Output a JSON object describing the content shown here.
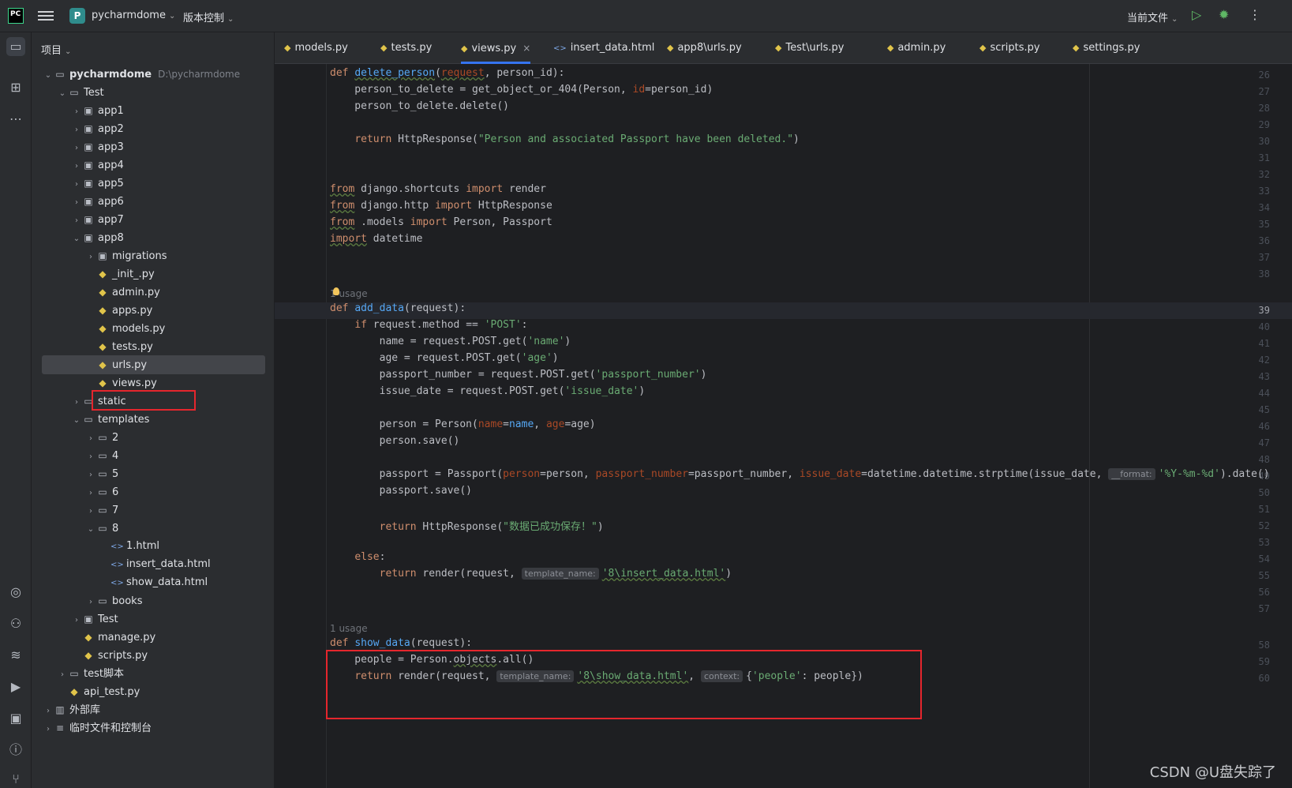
{
  "titlebar": {
    "logo": "PC",
    "project_badge": "P",
    "project_name": "pycharmdome",
    "vcs_label": "版本控制",
    "run_config": "当前文件"
  },
  "project_panel": {
    "title": "项目",
    "tree": [
      {
        "label": "pycharmdome",
        "hint": "D:\\pycharmdome",
        "type": "dir",
        "depth": 0,
        "expanded": true,
        "bold": true
      },
      {
        "label": "Test",
        "type": "dir",
        "depth": 1,
        "expanded": true
      },
      {
        "label": "app1",
        "type": "pkg",
        "depth": 2,
        "expanded": false
      },
      {
        "label": "app2",
        "type": "pkg",
        "depth": 2,
        "expanded": false
      },
      {
        "label": "app3",
        "type": "pkg",
        "depth": 2,
        "expanded": false
      },
      {
        "label": "app4",
        "type": "pkg",
        "depth": 2,
        "expanded": false
      },
      {
        "label": "app5",
        "type": "pkg",
        "depth": 2,
        "expanded": false
      },
      {
        "label": "app6",
        "type": "pkg",
        "depth": 2,
        "expanded": false
      },
      {
        "label": "app7",
        "type": "pkg",
        "depth": 2,
        "expanded": false
      },
      {
        "label": "app8",
        "type": "pkg",
        "depth": 2,
        "expanded": true
      },
      {
        "label": "migrations",
        "type": "pkg",
        "depth": 3,
        "expanded": false
      },
      {
        "label": "_init_.py",
        "type": "py",
        "depth": 3
      },
      {
        "label": "admin.py",
        "type": "py",
        "depth": 3
      },
      {
        "label": "apps.py",
        "type": "py",
        "depth": 3
      },
      {
        "label": "models.py",
        "type": "py",
        "depth": 3
      },
      {
        "label": "tests.py",
        "type": "py",
        "depth": 3
      },
      {
        "label": "urls.py",
        "type": "py",
        "depth": 3,
        "selected": true
      },
      {
        "label": "views.py",
        "type": "py",
        "depth": 3,
        "highlight": true
      },
      {
        "label": "static",
        "type": "dir",
        "depth": 2,
        "expanded": false
      },
      {
        "label": "templates",
        "type": "dir",
        "depth": 2,
        "expanded": true
      },
      {
        "label": "2",
        "type": "dir",
        "depth": 3,
        "expanded": false
      },
      {
        "label": "4",
        "type": "dir",
        "depth": 3,
        "expanded": false
      },
      {
        "label": "5",
        "type": "dir",
        "depth": 3,
        "expanded": false
      },
      {
        "label": "6",
        "type": "dir",
        "depth": 3,
        "expanded": false
      },
      {
        "label": "7",
        "type": "dir",
        "depth": 3,
        "expanded": false
      },
      {
        "label": "8",
        "type": "dir",
        "depth": 3,
        "expanded": true
      },
      {
        "label": "1.html",
        "type": "html",
        "depth": 4
      },
      {
        "label": "insert_data.html",
        "type": "html",
        "depth": 4
      },
      {
        "label": "show_data.html",
        "type": "html",
        "depth": 4
      },
      {
        "label": "books",
        "type": "dir",
        "depth": 3,
        "expanded": false
      },
      {
        "label": "Test",
        "type": "pkg",
        "depth": 2,
        "expanded": false
      },
      {
        "label": "manage.py",
        "type": "py",
        "depth": 2
      },
      {
        "label": "scripts.py",
        "type": "py",
        "depth": 2
      },
      {
        "label": "test脚本",
        "type": "dir",
        "depth": 1,
        "expanded": false
      },
      {
        "label": "api_test.py",
        "type": "py",
        "depth": 1
      },
      {
        "label": "外部库",
        "type": "lib",
        "depth": 0,
        "expanded": false
      },
      {
        "label": "临时文件和控制台",
        "type": "scratch",
        "depth": 0,
        "expanded": false
      }
    ]
  },
  "tabs": [
    {
      "label": "models.py",
      "type": "py"
    },
    {
      "label": "tests.py",
      "type": "py"
    },
    {
      "label": "views.py",
      "type": "py",
      "active": true
    },
    {
      "label": "insert_data.html",
      "type": "html"
    },
    {
      "label": "app8\\urls.py",
      "type": "py"
    },
    {
      "label": "Test\\urls.py",
      "type": "py"
    },
    {
      "label": "admin.py",
      "type": "py"
    },
    {
      "label": "scripts.py",
      "type": "py"
    },
    {
      "label": "settings.py",
      "type": "py"
    }
  ],
  "editor": {
    "current_line": "39",
    "lines": [
      {
        "n": "26",
        "tokens": [
          [
            "def ",
            "kw"
          ],
          [
            "delete_person",
            "fn ul"
          ],
          [
            "(",
            ""
          ],
          [
            "request",
            "pm ul"
          ],
          [
            ", person_id):",
            ""
          ]
        ]
      },
      {
        "n": "27",
        "tokens": [
          [
            "    person_to_delete = get_object_or_404(Person, ",
            ""
          ],
          [
            "id",
            "pm"
          ],
          [
            "=person_id)",
            ""
          ]
        ]
      },
      {
        "n": "28",
        "tokens": [
          [
            "    person_to_delete.delete()",
            ""
          ]
        ]
      },
      {
        "n": "29",
        "tokens": []
      },
      {
        "n": "30",
        "tokens": [
          [
            "    ",
            ""
          ],
          [
            "return",
            "kw"
          ],
          [
            " HttpResponse(",
            ""
          ],
          [
            "\"Person and associated Passport have been deleted.\"",
            "st"
          ],
          [
            ")",
            ""
          ]
        ]
      },
      {
        "n": "31",
        "tokens": []
      },
      {
        "n": "32",
        "tokens": []
      },
      {
        "n": "33",
        "tokens": [
          [
            "from",
            "kw ul"
          ],
          [
            " django.shortcuts ",
            ""
          ],
          [
            "import",
            "kw"
          ],
          [
            " render",
            ""
          ]
        ]
      },
      {
        "n": "34",
        "tokens": [
          [
            "from",
            "kw ul"
          ],
          [
            " django.http ",
            ""
          ],
          [
            "import",
            "kw"
          ],
          [
            " HttpResponse",
            ""
          ]
        ]
      },
      {
        "n": "35",
        "tokens": [
          [
            "from",
            "kw ul"
          ],
          [
            " .models ",
            ""
          ],
          [
            "import",
            "kw"
          ],
          [
            " Person, Passport",
            ""
          ]
        ]
      },
      {
        "n": "36",
        "tokens": [
          [
            "import",
            "kw ul"
          ],
          [
            " datetime",
            ""
          ]
        ]
      },
      {
        "n": "37",
        "tokens": []
      },
      {
        "n": "38",
        "tokens": []
      },
      {
        "n": "39",
        "usage": "1 usage",
        "tokens": [
          [
            "def ",
            "kw"
          ],
          [
            "add_data",
            "fn"
          ],
          [
            "(request):",
            ""
          ]
        ]
      },
      {
        "n": "40",
        "tokens": [
          [
            "    ",
            ""
          ],
          [
            "if",
            "kw"
          ],
          [
            " request.method == ",
            ""
          ],
          [
            "'POST'",
            "st"
          ],
          [
            ":",
            ""
          ]
        ]
      },
      {
        "n": "41",
        "tokens": [
          [
            "        name = request.POST.get(",
            ""
          ],
          [
            "'name'",
            "st"
          ],
          [
            ")",
            ""
          ]
        ]
      },
      {
        "n": "42",
        "tokens": [
          [
            "        age = request.POST.get(",
            ""
          ],
          [
            "'age'",
            "st"
          ],
          [
            ")",
            ""
          ]
        ]
      },
      {
        "n": "43",
        "tokens": [
          [
            "        passport_number = request.POST.get(",
            ""
          ],
          [
            "'passport_number'",
            "st"
          ],
          [
            ")",
            ""
          ]
        ]
      },
      {
        "n": "44",
        "tokens": [
          [
            "        issue_date = request.POST.get(",
            ""
          ],
          [
            "'issue_date'",
            "st"
          ],
          [
            ")",
            ""
          ]
        ]
      },
      {
        "n": "45",
        "tokens": []
      },
      {
        "n": "46",
        "tokens": [
          [
            "        person = Person(",
            ""
          ],
          [
            "name",
            "pm"
          ],
          [
            "=",
            ""
          ],
          [
            "name",
            "fn"
          ],
          [
            ", ",
            ""
          ],
          [
            "age",
            "pm"
          ],
          [
            "=age)",
            ""
          ]
        ]
      },
      {
        "n": "47",
        "tokens": [
          [
            "        person.save()",
            ""
          ]
        ]
      },
      {
        "n": "48",
        "tokens": []
      },
      {
        "n": "49",
        "tokens": [
          [
            "        passport = Passport(",
            ""
          ],
          [
            "person",
            "pm"
          ],
          [
            "=person, ",
            ""
          ],
          [
            "passport_number",
            "pm"
          ],
          [
            "=passport_number, ",
            ""
          ],
          [
            "issue_date",
            "pm"
          ],
          [
            "=datetime.datetime.strptime(issue_date, ",
            ""
          ],
          [
            "__format:",
            "ih"
          ],
          [
            "'%Y-%m-%d'",
            "st"
          ],
          [
            ").date()",
            ""
          ]
        ]
      },
      {
        "n": "50",
        "tokens": [
          [
            "        passport.save()",
            ""
          ]
        ]
      },
      {
        "n": "51",
        "tokens": []
      },
      {
        "n": "52",
        "tokens": [
          [
            "        ",
            ""
          ],
          [
            "return",
            "kw"
          ],
          [
            " HttpResponse(",
            ""
          ],
          [
            "\"数据已成功保存！\"",
            "st"
          ],
          [
            ")",
            ""
          ]
        ]
      },
      {
        "n": "53",
        "tokens": []
      },
      {
        "n": "54",
        "tokens": [
          [
            "    ",
            ""
          ],
          [
            "else",
            "kw"
          ],
          [
            ":",
            ""
          ]
        ]
      },
      {
        "n": "55",
        "tokens": [
          [
            "        ",
            ""
          ],
          [
            "return",
            "kw"
          ],
          [
            " render(request, ",
            ""
          ],
          [
            "template_name:",
            "ih"
          ],
          [
            "'8\\insert_data.html'",
            "st ul"
          ],
          [
            ")",
            ""
          ]
        ]
      },
      {
        "n": "56",
        "tokens": []
      },
      {
        "n": "57",
        "tokens": []
      },
      {
        "n": "58",
        "usage": "1 usage",
        "tokens": [
          [
            "def ",
            "kw"
          ],
          [
            "show_data",
            "fn"
          ],
          [
            "(request):",
            ""
          ]
        ]
      },
      {
        "n": "59",
        "tokens": [
          [
            "    people = Person.",
            ""
          ],
          [
            "objects",
            "ul"
          ],
          [
            ".all()",
            ""
          ]
        ]
      },
      {
        "n": "60",
        "tokens": [
          [
            "    ",
            ""
          ],
          [
            "return",
            "kw"
          ],
          [
            " render(request, ",
            ""
          ],
          [
            "template_name:",
            "ih"
          ],
          [
            "'8\\show_data.html'",
            "st ul"
          ],
          [
            ", ",
            ""
          ],
          [
            "context:",
            "ih"
          ],
          [
            "{",
            ""
          ],
          [
            "'people'",
            "st"
          ],
          [
            ": people})",
            ""
          ]
        ]
      }
    ]
  },
  "watermark": "CSDN @U盘失踪了"
}
